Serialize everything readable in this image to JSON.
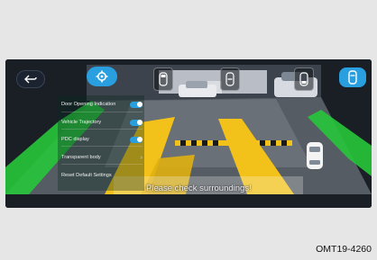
{
  "menu": {
    "items": [
      {
        "label": "Door Opening Indication",
        "control": "toggle",
        "state": "on"
      },
      {
        "label": "Vehicle Trajectory",
        "control": "toggle",
        "state": "on"
      },
      {
        "label": "PDC display",
        "control": "toggle",
        "state": "on"
      },
      {
        "label": "Transparent body",
        "control": "chevron",
        "chevron": "›"
      },
      {
        "label": "Reset Default Settings",
        "control": "none"
      }
    ]
  },
  "warning_text": "Please check surroundings!",
  "caption": "OMT19-4260",
  "colors": {
    "accent": "#2a9fe0",
    "guide_yellow": "#f2c21a",
    "guide_green": "#27c63b"
  },
  "icons": {
    "back": "back-arrow-icon",
    "settings": "gear-icon",
    "front_view": "car-front-view-icon",
    "rear_view": "car-rear-view-icon",
    "side_view": "car-side-view-icon",
    "view_mode": "car-view-mode-icon"
  }
}
